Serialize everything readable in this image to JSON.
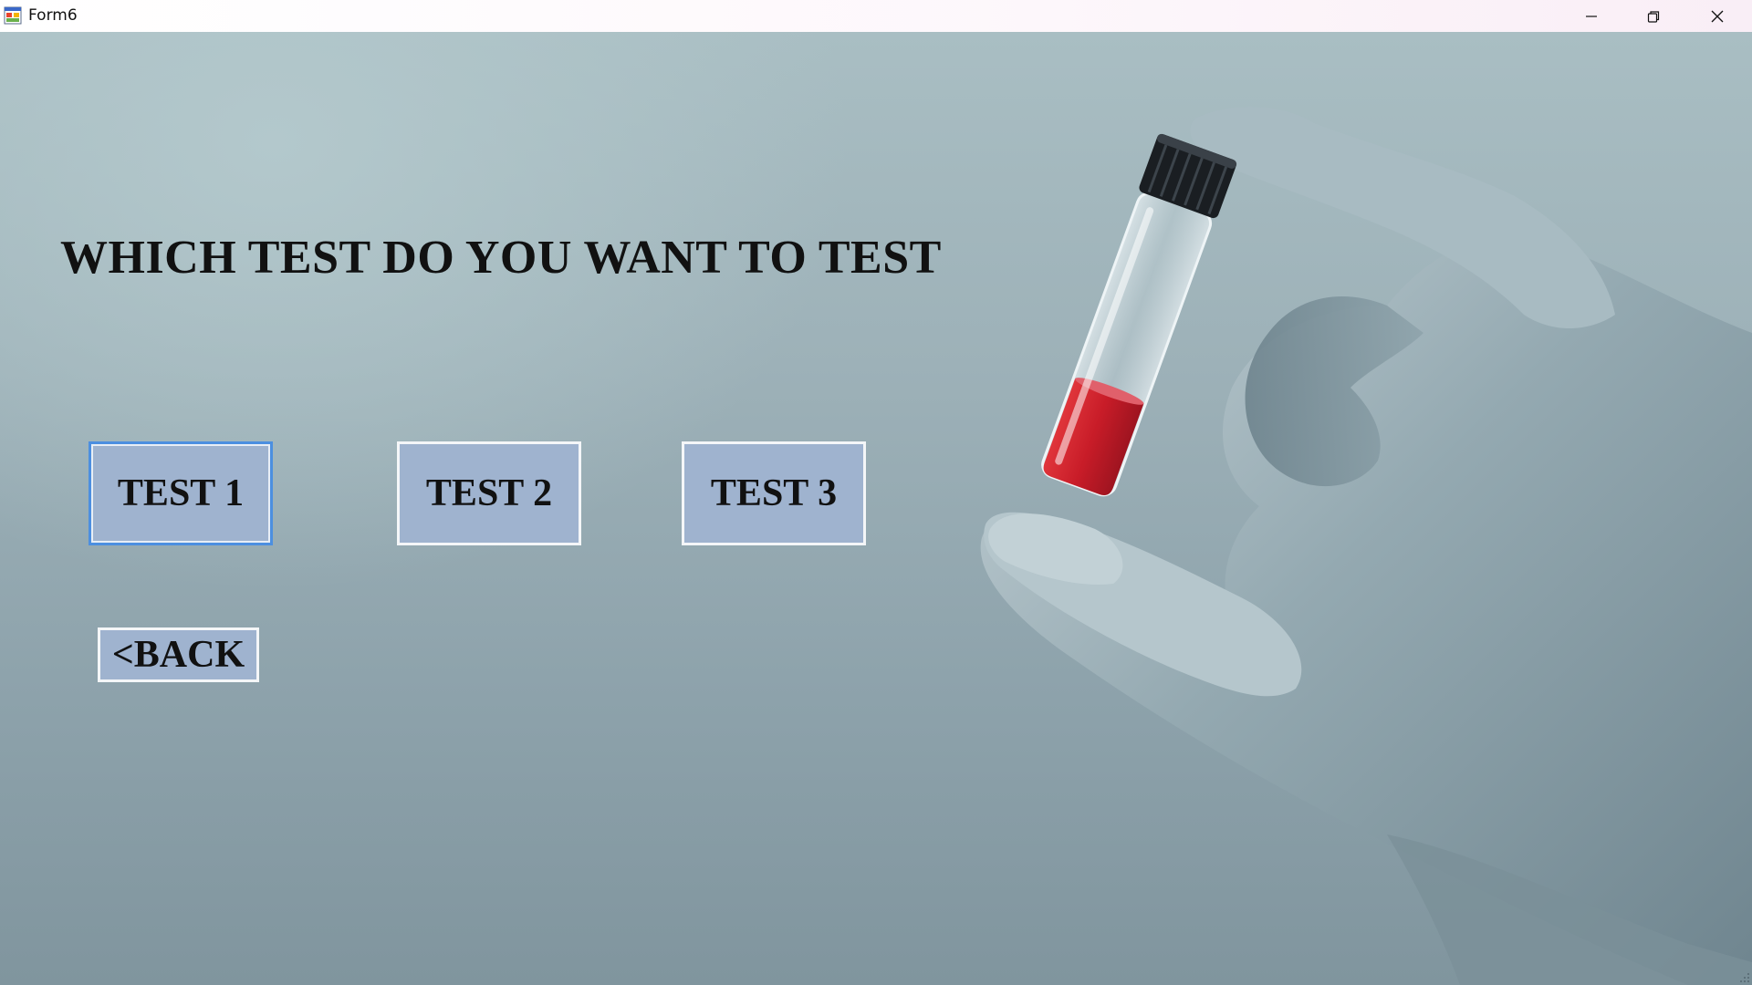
{
  "window": {
    "title": "Form6",
    "minimize_icon": "minimize-icon",
    "restore_icon": "restore-icon",
    "close_icon": "close-icon"
  },
  "main": {
    "heading": "WHICH TEST DO YOU WANT TO TEST",
    "buttons": {
      "test1": "TEST 1",
      "test2": "TEST 2",
      "test3": "TEST 3",
      "back": "<BACK"
    }
  },
  "colors": {
    "button_fill": "#9fb3cf",
    "focus_border": "#4c8fe0",
    "liquid": "#c8202a",
    "glove": "#8fa3ab"
  }
}
